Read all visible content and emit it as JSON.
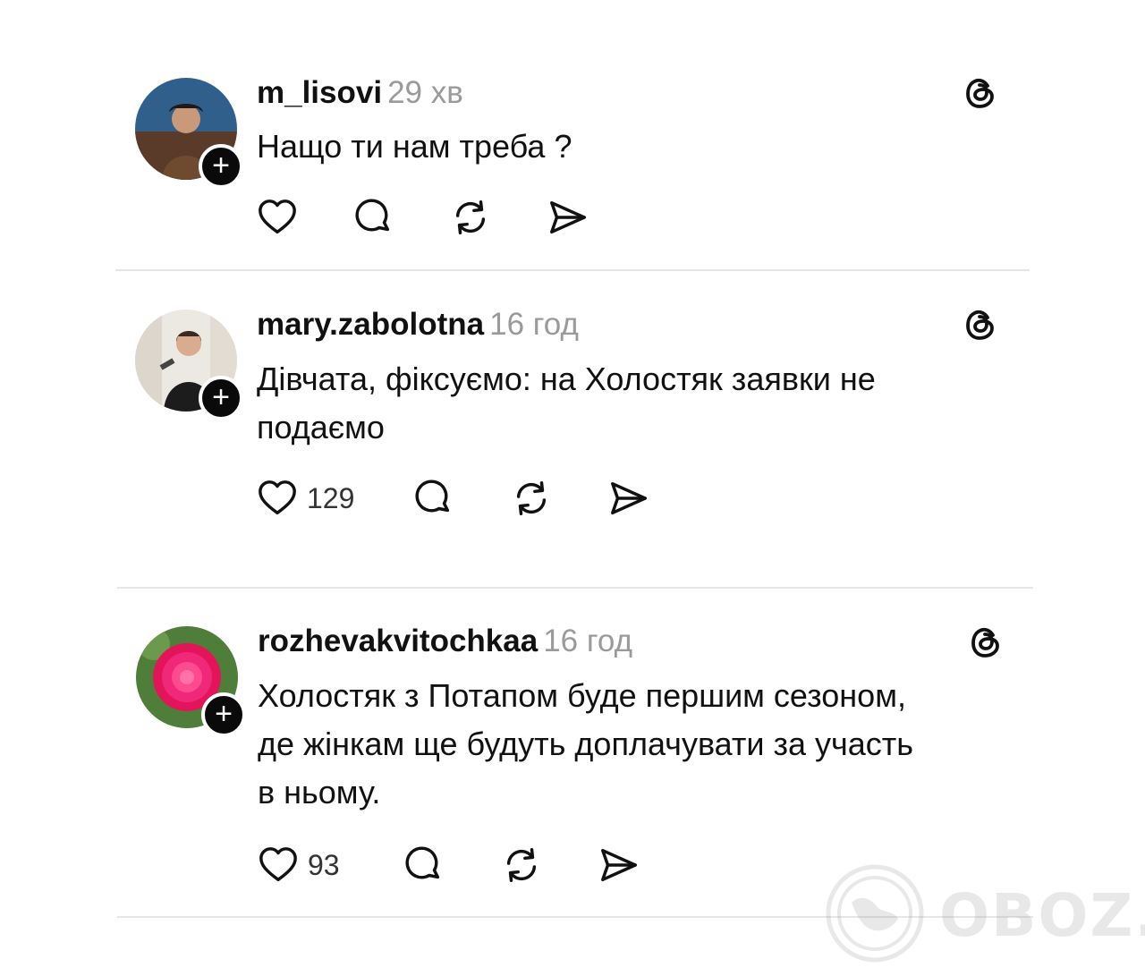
{
  "posts": [
    {
      "username": "m_lisovi",
      "time": "29 хв",
      "text_lines": [
        "Нащо ти нам треба ?"
      ],
      "likes": ""
    },
    {
      "username": "mary.zabolotna",
      "time": "16 год",
      "text_lines": [
        "Дівчата, фіксуємо: на Холостяк заявки не",
        "подаємо"
      ],
      "likes": "129"
    },
    {
      "username": "rozhevakvitochkaa",
      "time": "16 год",
      "text_lines": [
        "Холостяк з Потапом буде першим сезоном,",
        "де жінкам ще будуть доплачувати за участь",
        "в ньому."
      ],
      "likes": "93"
    }
  ],
  "follow_symbol": "+",
  "watermark": "OBOZ.UA",
  "icons": [
    "threads-logo-icon",
    "heart-icon",
    "comment-icon",
    "repost-icon",
    "share-icon",
    "globe-icon"
  ],
  "colors": {
    "text": "#111111",
    "muted": "#9a9a9a",
    "divider": "#e6e6e6",
    "follow_bg": "#0a0a0a"
  }
}
